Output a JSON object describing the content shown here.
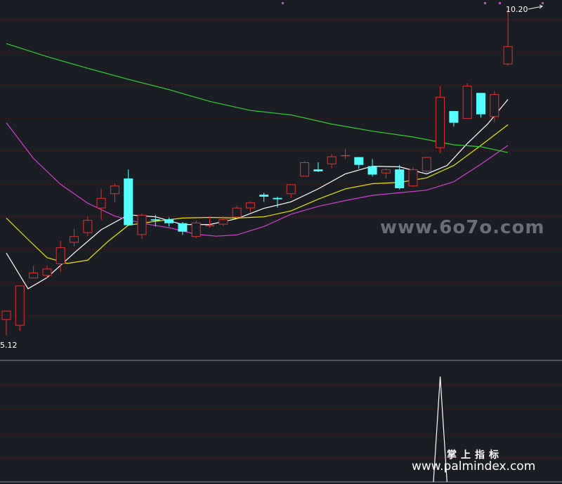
{
  "chart_data": {
    "type": "candlestick",
    "price_low_label": "5.12",
    "price_high_label": "10.20",
    "ylim": [
      5.0,
      10.25
    ],
    "candles": [
      {
        "o": 5.42,
        "c": 5.56,
        "h": 5.56,
        "l": 5.18
      },
      {
        "o": 5.33,
        "c": 5.95,
        "h": 5.95,
        "l": 5.25
      },
      {
        "o": 6.06,
        "c": 6.15,
        "h": 6.25,
        "l": 6.06
      },
      {
        "o": 6.1,
        "c": 6.21,
        "h": 6.26,
        "l": 6.06
      },
      {
        "o": 6.28,
        "c": 6.54,
        "h": 6.64,
        "l": 6.16
      },
      {
        "o": 6.61,
        "c": 6.71,
        "h": 6.82,
        "l": 6.55
      },
      {
        "o": 6.76,
        "c": 6.96,
        "h": 7.02,
        "l": 6.71
      },
      {
        "o": 7.14,
        "c": 7.3,
        "h": 7.44,
        "l": 6.96
      },
      {
        "o": 7.36,
        "c": 7.49,
        "h": 7.52,
        "l": 7.23
      },
      {
        "o": 7.6,
        "c": 6.88,
        "h": 7.74,
        "l": 6.88
      },
      {
        "o": 6.73,
        "c": 7.04,
        "h": 7.06,
        "l": 6.67
      },
      {
        "o": 6.97,
        "c": 6.95,
        "h": 7.04,
        "l": 6.86
      },
      {
        "o": 6.97,
        "c": 6.91,
        "h": 7.0,
        "l": 6.86
      },
      {
        "o": 6.91,
        "c": 6.78,
        "h": 6.93,
        "l": 6.73
      },
      {
        "o": 6.7,
        "c": 6.92,
        "h": 6.95,
        "l": 6.68
      },
      {
        "o": 6.88,
        "c": 6.88,
        "h": 7.02,
        "l": 6.84
      },
      {
        "o": 6.89,
        "c": 6.97,
        "h": 7.02,
        "l": 6.87
      },
      {
        "o": 7.0,
        "c": 7.15,
        "h": 7.18,
        "l": 6.98
      },
      {
        "o": 7.14,
        "c": 7.23,
        "h": 7.24,
        "l": 7.08
      },
      {
        "o": 7.35,
        "c": 7.32,
        "h": 7.38,
        "l": 7.24
      },
      {
        "o": 7.3,
        "c": 7.28,
        "h": 7.32,
        "l": 7.15
      },
      {
        "o": 7.36,
        "c": 7.51,
        "h": 7.51,
        "l": 7.3
      },
      {
        "o": 7.63,
        "c": 7.85,
        "h": 7.87,
        "l": 7.63
      },
      {
        "o": 7.74,
        "c": 7.71,
        "h": 7.85,
        "l": 7.7
      },
      {
        "o": 7.82,
        "c": 7.94,
        "h": 7.98,
        "l": 7.76
      },
      {
        "o": 7.96,
        "c": 7.96,
        "h": 8.06,
        "l": 7.9
      },
      {
        "o": 7.93,
        "c": 7.81,
        "h": 7.93,
        "l": 7.75
      },
      {
        "o": 7.79,
        "c": 7.66,
        "h": 7.9,
        "l": 7.63
      },
      {
        "o": 7.68,
        "c": 7.74,
        "h": 7.76,
        "l": 7.6
      },
      {
        "o": 7.74,
        "c": 7.45,
        "h": 7.81,
        "l": 7.43
      },
      {
        "o": 7.48,
        "c": 7.74,
        "h": 7.77,
        "l": 7.47
      },
      {
        "o": 7.71,
        "c": 7.93,
        "h": 7.93,
        "l": 7.69
      },
      {
        "o": 8.07,
        "c": 8.86,
        "h": 9.03,
        "l": 7.99
      },
      {
        "o": 8.64,
        "c": 8.46,
        "h": 8.64,
        "l": 8.4
      },
      {
        "o": 8.52,
        "c": 9.03,
        "h": 9.07,
        "l": 8.52
      },
      {
        "o": 8.92,
        "c": 8.59,
        "h": 8.92,
        "l": 8.54
      },
      {
        "o": 8.55,
        "c": 8.9,
        "h": 8.95,
        "l": 8.47
      },
      {
        "o": 9.36,
        "c": 9.64,
        "h": 10.2,
        "l": 9.34
      }
    ],
    "ma_series": [
      {
        "color": "#ffffff",
        "values": [
          [
            0,
            6.45
          ],
          [
            1.6,
            5.9
          ],
          [
            3,
            6.07
          ],
          [
            5,
            6.45
          ],
          [
            7,
            6.81
          ],
          [
            9,
            7.04
          ],
          [
            11,
            7.01
          ],
          [
            13,
            6.89
          ],
          [
            15,
            6.89
          ],
          [
            17,
            6.98
          ],
          [
            19,
            7.14
          ],
          [
            21,
            7.24
          ],
          [
            23,
            7.44
          ],
          [
            25,
            7.67
          ],
          [
            27,
            7.79
          ],
          [
            29,
            7.78
          ],
          [
            31,
            7.67
          ],
          [
            32.5,
            7.8
          ],
          [
            34,
            8.14
          ],
          [
            35.5,
            8.44
          ],
          [
            37,
            8.82
          ]
        ]
      },
      {
        "color": "#e6e600",
        "values": [
          [
            0,
            6.99
          ],
          [
            1.5,
            6.68
          ],
          [
            3,
            6.38
          ],
          [
            4.5,
            6.29
          ],
          [
            6,
            6.34
          ],
          [
            7.5,
            6.63
          ],
          [
            9,
            6.88
          ],
          [
            11,
            6.94
          ],
          [
            13,
            6.99
          ],
          [
            15,
            7.0
          ],
          [
            17,
            6.99
          ],
          [
            19,
            7.01
          ],
          [
            21,
            7.1
          ],
          [
            23,
            7.28
          ],
          [
            25,
            7.44
          ],
          [
            27,
            7.52
          ],
          [
            29,
            7.54
          ],
          [
            31,
            7.61
          ],
          [
            33,
            7.8
          ],
          [
            35,
            8.11
          ],
          [
            37,
            8.43
          ]
        ]
      },
      {
        "color": "#d23fd2",
        "values": [
          [
            0,
            8.46
          ],
          [
            2,
            7.91
          ],
          [
            4,
            7.51
          ],
          [
            6,
            7.22
          ],
          [
            8,
            7.02
          ],
          [
            10,
            6.91
          ],
          [
            12,
            6.84
          ],
          [
            14,
            6.74
          ],
          [
            15.5,
            6.71
          ],
          [
            17,
            6.73
          ],
          [
            19,
            6.86
          ],
          [
            21,
            7.05
          ],
          [
            23,
            7.17
          ],
          [
            25,
            7.26
          ],
          [
            27,
            7.34
          ],
          [
            29,
            7.38
          ],
          [
            31,
            7.42
          ],
          [
            33,
            7.55
          ],
          [
            35,
            7.82
          ],
          [
            37,
            8.11
          ]
        ]
      },
      {
        "color": "#2dd22d",
        "values": [
          [
            0,
            9.68
          ],
          [
            3,
            9.48
          ],
          [
            6,
            9.3
          ],
          [
            9,
            9.13
          ],
          [
            12,
            8.97
          ],
          [
            15,
            8.79
          ],
          [
            18,
            8.65
          ],
          [
            21,
            8.58
          ],
          [
            24,
            8.44
          ],
          [
            27,
            8.33
          ],
          [
            30,
            8.24
          ],
          [
            33,
            8.12
          ],
          [
            35,
            8.09
          ],
          [
            37,
            8.0
          ]
        ]
      }
    ],
    "indicator": {
      "x": [
        31.5,
        32,
        32.5
      ],
      "values": [
        0,
        1,
        0
      ]
    }
  },
  "watermark": {
    "site_6070": "www.6o7o.com",
    "site_palmindex": "www.palmindex.com",
    "cn_label": "掌上指标"
  },
  "colors": {
    "background": "#1b1d25",
    "up": "#e03030",
    "down": "#54ffff",
    "grid": "#7a1a1a"
  }
}
